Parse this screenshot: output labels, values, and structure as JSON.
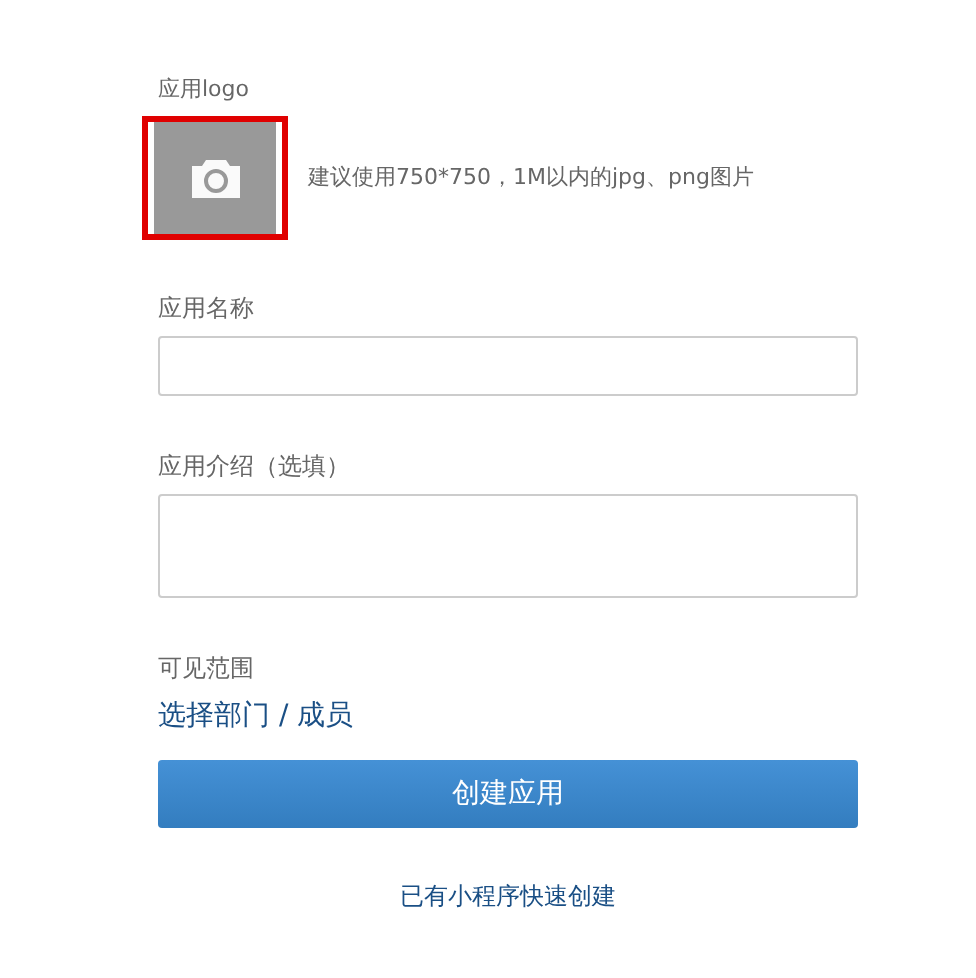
{
  "logo": {
    "label": "应用logo",
    "highlighted": true,
    "hint": "建议使用750*750，1M以内的jpg、png图片"
  },
  "name_field": {
    "label": "应用名称"
  },
  "intro_field": {
    "label": "应用介绍（选填）"
  },
  "visibility": {
    "label": "可见范围",
    "link": "选择部门 / 成员"
  },
  "submit_button": "创建应用",
  "footer_link": "已有小程序快速创建"
}
